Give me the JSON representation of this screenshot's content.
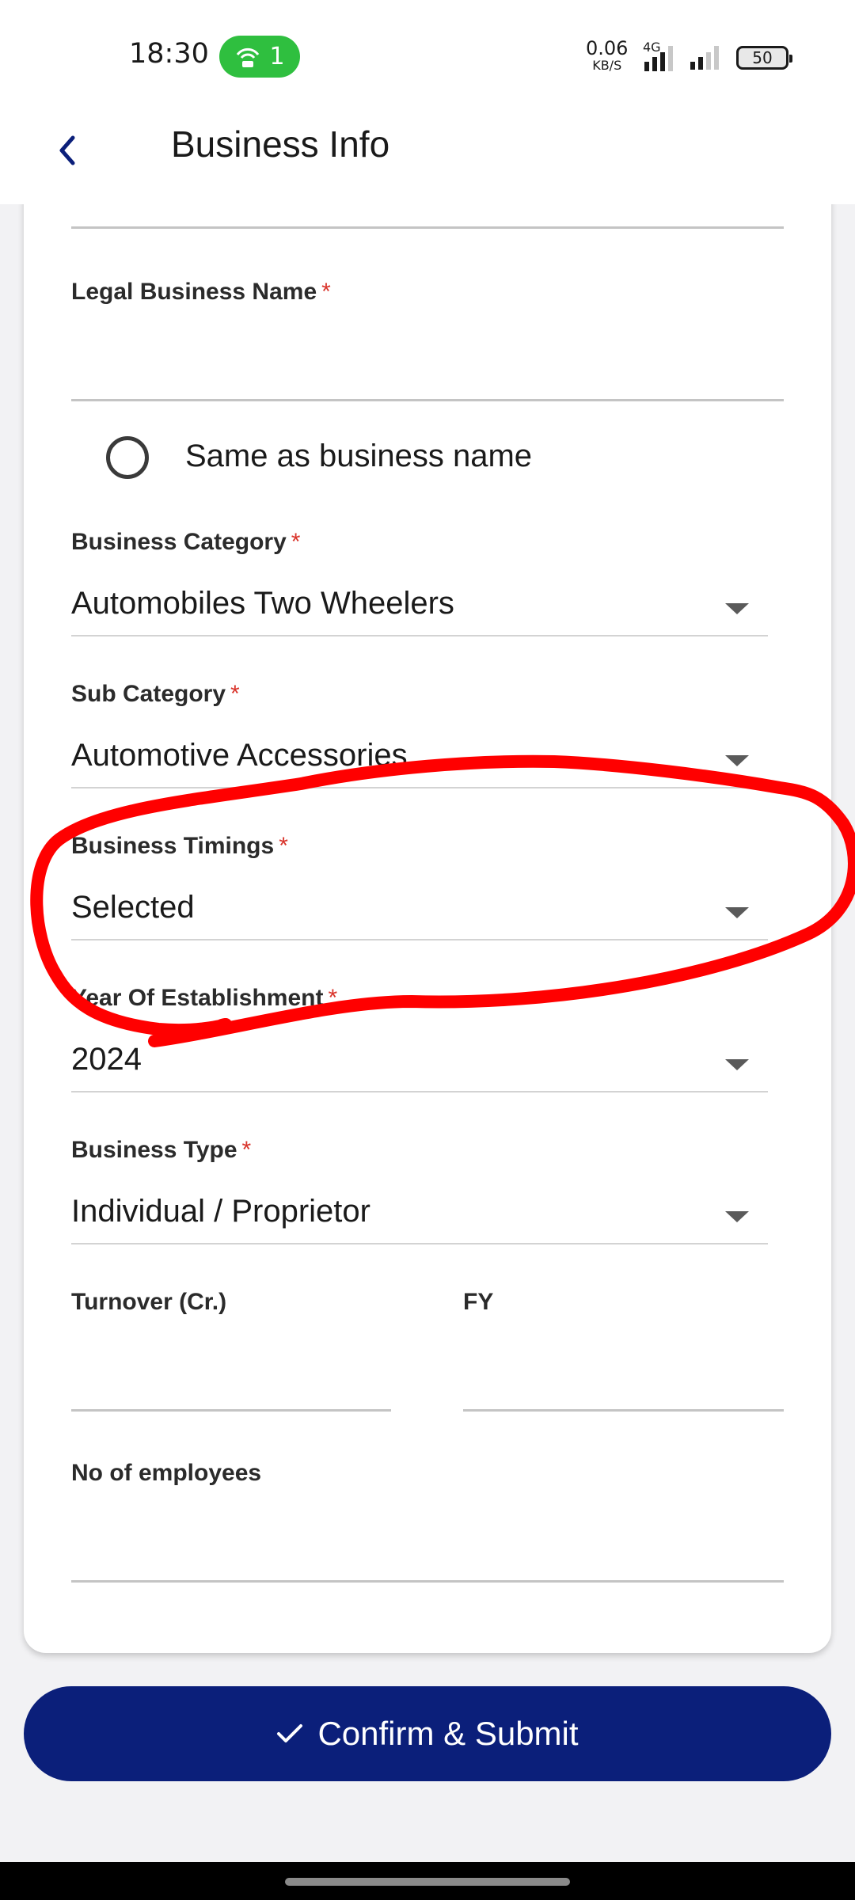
{
  "status_bar": {
    "time": "18:30",
    "hotspot_count": "1",
    "net_speed": "0.06",
    "net_speed_unit": "KB/S",
    "network_type": "4G",
    "battery": "50"
  },
  "header": {
    "title": "Business Info",
    "back_icon": "chevron-left-icon"
  },
  "form": {
    "legal_name": {
      "label": "Legal Business Name",
      "required": "*",
      "value": ""
    },
    "same_as_business": {
      "label": "Same as business name",
      "checked": false
    },
    "business_category": {
      "label": "Business Category",
      "required": "*",
      "value": "Automobiles Two Wheelers"
    },
    "sub_category": {
      "label": "Sub Category",
      "required": "*",
      "value": "Automotive Accessories"
    },
    "business_timings": {
      "label": "Business Timings",
      "required": "*",
      "value": "Selected"
    },
    "year_of_establishment": {
      "label": "Year Of Establishment",
      "required": "*",
      "value": "2024"
    },
    "business_type": {
      "label": "Business Type",
      "required": "*",
      "value": "Individual / Proprietor"
    },
    "turnover": {
      "label": "Turnover (Cr.)",
      "value": ""
    },
    "fy": {
      "label": "FY",
      "value": ""
    },
    "employees": {
      "label": "No of employees",
      "value": ""
    }
  },
  "submit": {
    "label": "Confirm & Submit",
    "icon": "check-icon"
  },
  "colors": {
    "primary": "#0b1f7a",
    "required": "#d9342b",
    "annotation": "#ff0000",
    "hotspot": "#2fbf3f"
  }
}
